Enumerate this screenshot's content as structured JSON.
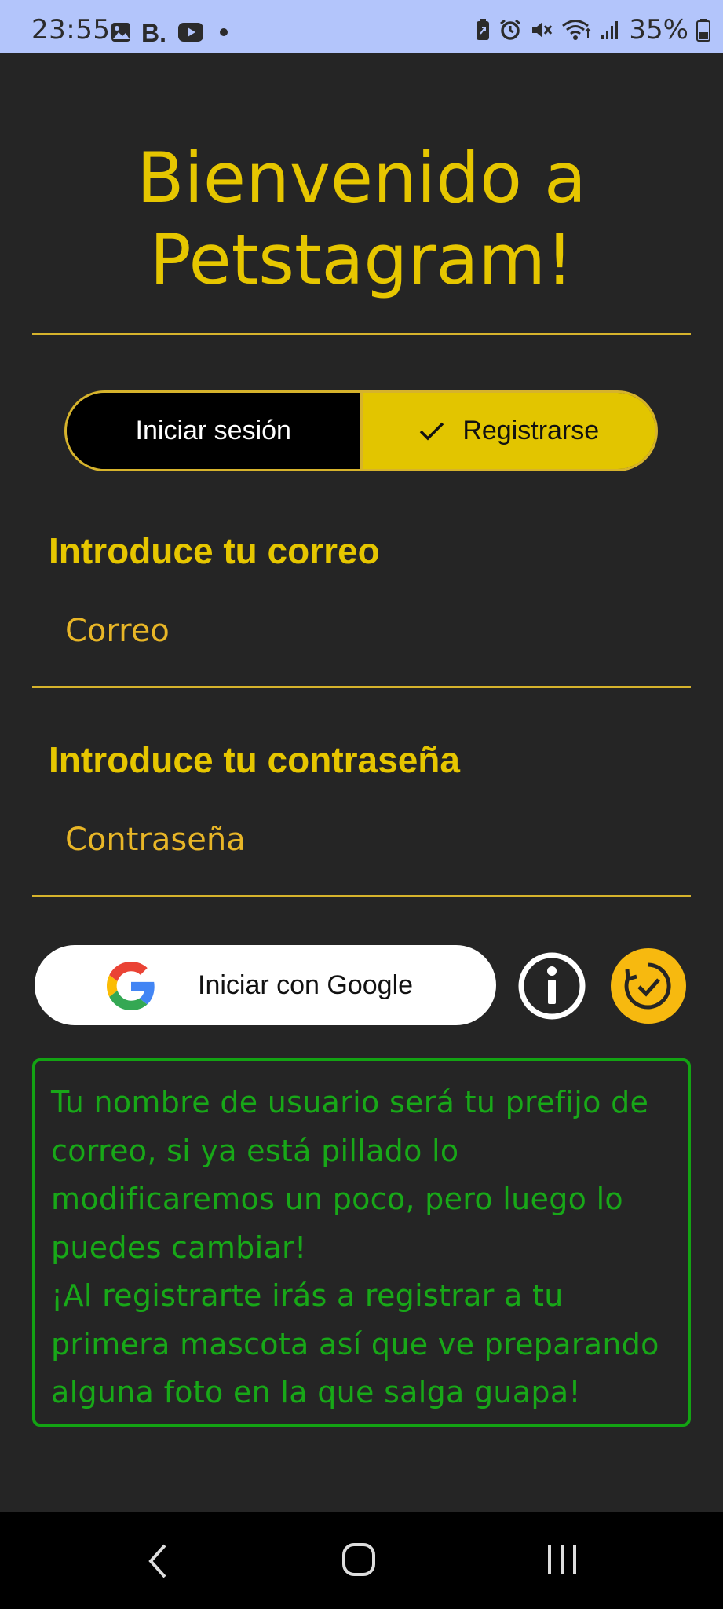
{
  "status_bar": {
    "time": "23:55",
    "battery_percent": "35%",
    "left_icons": [
      "gallery-icon",
      "booking-icon",
      "youtube-icon",
      "dot-icon"
    ],
    "right_icons": [
      "battery-saver-icon",
      "alarm-icon",
      "mute-icon",
      "wifi-icon",
      "signal-icon",
      "battery-icon"
    ]
  },
  "header": {
    "title_line1": "Bienvenido a",
    "title_line2": "Petstagram!"
  },
  "mode_toggle": {
    "login_label": "Iniciar sesión",
    "register_label": "Registrarse",
    "selected": "register"
  },
  "email": {
    "label": "Introduce tu correo",
    "placeholder": "Correo",
    "value": ""
  },
  "password": {
    "label": "Introduce tu contraseña",
    "placeholder": "Contraseña",
    "value": ""
  },
  "google_button": {
    "label": "Iniciar con Google"
  },
  "info_message": {
    "line1": "Tu nombre de usuario será tu prefijo de correo, si ya está pillado lo modificaremos un poco, pero luego lo puedes cambiar!",
    "line2": "¡Al registrarte irás a registrar a tu primera mascota así que ve preparando alguna foto en la que salga guapa!"
  },
  "colors": {
    "background": "#252525",
    "accent_yellow": "#e2c500",
    "info_green": "#18a818",
    "status_bar": "#b3c5fb"
  }
}
